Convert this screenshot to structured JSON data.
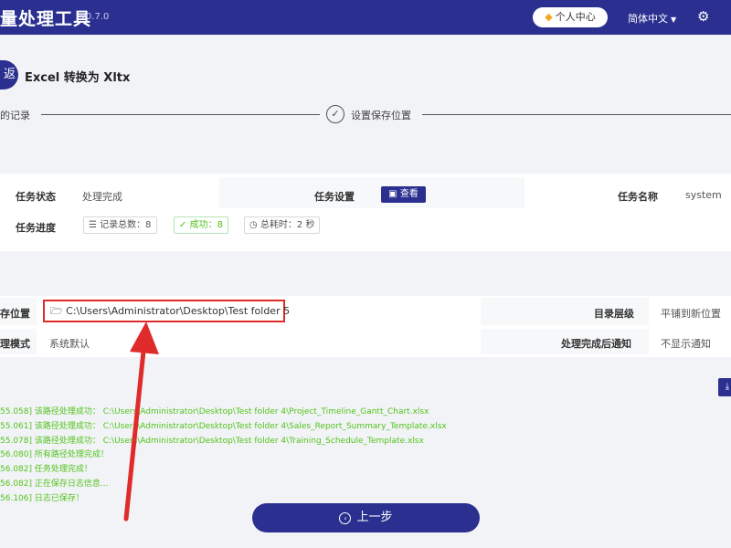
{
  "header": {
    "app_title": "量处理工具",
    "version": "v0.7.0",
    "user_center": "个人中心",
    "language": "简体中文"
  },
  "page": {
    "back_label": "返",
    "title": "Excel 转换为 Xltx"
  },
  "steps": {
    "step1_label": "的记录",
    "step2_label": "设置保存位置"
  },
  "task_info": {
    "status_label": "任务状态",
    "status_value": "处理完成",
    "settings_label": "任务设置",
    "view_button": "查看",
    "name_label": "任务名称",
    "name_value": "system",
    "progress_label": "任务进度",
    "record_total": "记录总数：8",
    "success": "成功：8",
    "elapsed": "总耗时：2 秒"
  },
  "save_info": {
    "location_label": "存位置",
    "path": "C:\\Users\\Administrator\\Desktop\\Test folder 5",
    "level_label": "目录层级",
    "level_value": "平铺到新位置",
    "mode_label": "理模式",
    "mode_value": "系统默认",
    "notify_label": "处理完成后通知",
    "notify_value": "不显示通知"
  },
  "log_lines": [
    "55.058] 该路径处理成功：  C:\\Users\\Administrator\\Desktop\\Test folder 4\\Project_Timeline_Gantt_Chart.xlsx",
    "55.061] 该路径处理成功：  C:\\Users\\Administrator\\Desktop\\Test folder 4\\Sales_Report_Summary_Template.xlsx",
    "55.078] 该路径处理成功：  C:\\Users\\Administrator\\Desktop\\Test folder 4\\Training_Schedule_Template.xlsx",
    "56.080] 所有路径处理完成！",
    "56.082] 任务处理完成！",
    "56.082] 正在保存日志信息...",
    "56.106] 日志已保存！"
  ],
  "footer": {
    "prev_button": "上一步"
  },
  "colors": {
    "primary": "#2b3090",
    "success": "#52c41a",
    "highlight": "#e02b2b"
  }
}
